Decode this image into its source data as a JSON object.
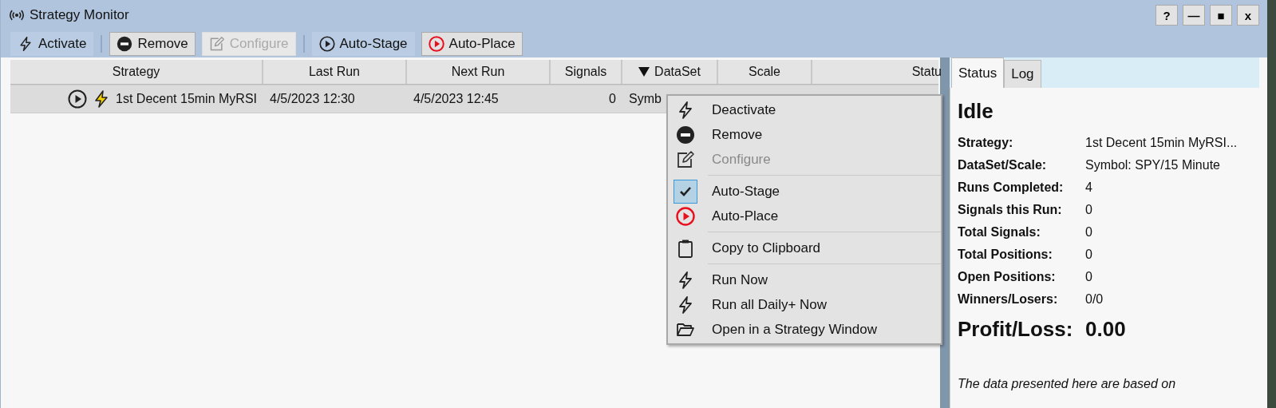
{
  "window": {
    "title": "Strategy Monitor",
    "buttons": [
      "?",
      "—",
      "■",
      "x"
    ]
  },
  "toolbar": {
    "groups": [
      {
        "buttons": [
          {
            "label": "Activate",
            "pressed": true,
            "disabled": false
          }
        ]
      },
      {
        "buttons": [
          {
            "label": "Remove",
            "pressed": false,
            "disabled": false
          },
          {
            "label": "Configure",
            "pressed": false,
            "disabled": true
          }
        ]
      },
      {
        "buttons": [
          {
            "label": "Auto-Stage",
            "pressed": true,
            "disabled": false
          },
          {
            "label": "Auto-Place",
            "pressed": false,
            "disabled": false
          }
        ]
      }
    ]
  },
  "table": {
    "columns": [
      {
        "label": "Strategy",
        "sorted": false
      },
      {
        "label": "Last Run",
        "sorted": false
      },
      {
        "label": "Next Run",
        "sorted": false
      },
      {
        "label": "Signals",
        "sorted": false
      },
      {
        "label": "DataSet",
        "sorted": true
      },
      {
        "label": "Scale",
        "sorted": false
      },
      {
        "label": "Statu",
        "sorted": false
      }
    ],
    "rows": [
      {
        "selected": true,
        "cells": [
          "1st Decent 15min MyRSI",
          "4/5/2023 12:30",
          "4/5/2023 12:45",
          "0",
          "Symb"
        ]
      }
    ]
  },
  "menu": {
    "groups": [
      {
        "items": [
          {
            "label": "Deactivate",
            "disabled": false,
            "checked": false
          },
          {
            "label": "Remove",
            "disabled": false,
            "checked": false
          },
          {
            "label": "Configure",
            "disabled": true,
            "checked": false
          }
        ]
      },
      {
        "items": [
          {
            "label": "Auto-Stage",
            "disabled": false,
            "checked": true
          },
          {
            "label": "Auto-Place",
            "disabled": false,
            "checked": false
          }
        ]
      },
      {
        "items": [
          {
            "label": "Copy to Clipboard",
            "disabled": false,
            "checked": false
          }
        ]
      },
      {
        "items": [
          {
            "label": "Run Now",
            "disabled": false,
            "checked": false
          },
          {
            "label": "Run all Daily+ Now",
            "disabled": false,
            "checked": false
          },
          {
            "label": "Open in a Strategy Window",
            "disabled": false,
            "checked": false
          }
        ]
      }
    ]
  },
  "panel": {
    "tabs": [
      {
        "label": "Status",
        "selected": true
      },
      {
        "label": "Log",
        "selected": false
      }
    ],
    "state": "Idle",
    "fields": [
      {
        "label": "Strategy:",
        "value": "1st Decent 15min MyRSI..."
      },
      {
        "label": "DataSet/Scale:",
        "value": "Symbol: SPY/15 Minute"
      },
      {
        "label": "Runs Completed:",
        "value": "4"
      },
      {
        "label": "Signals this Run:",
        "value": "0"
      },
      {
        "label": "Total Signals:",
        "value": "0"
      },
      {
        "label": "Total Positions:",
        "value": "0"
      },
      {
        "label": "Open Positions:",
        "value": "0"
      },
      {
        "label": "Winners/Losers:",
        "value": "0/0"
      }
    ],
    "profit": {
      "label": "Profit/Loss:",
      "value": "0.00"
    },
    "note": "The data presented here are based on"
  }
}
